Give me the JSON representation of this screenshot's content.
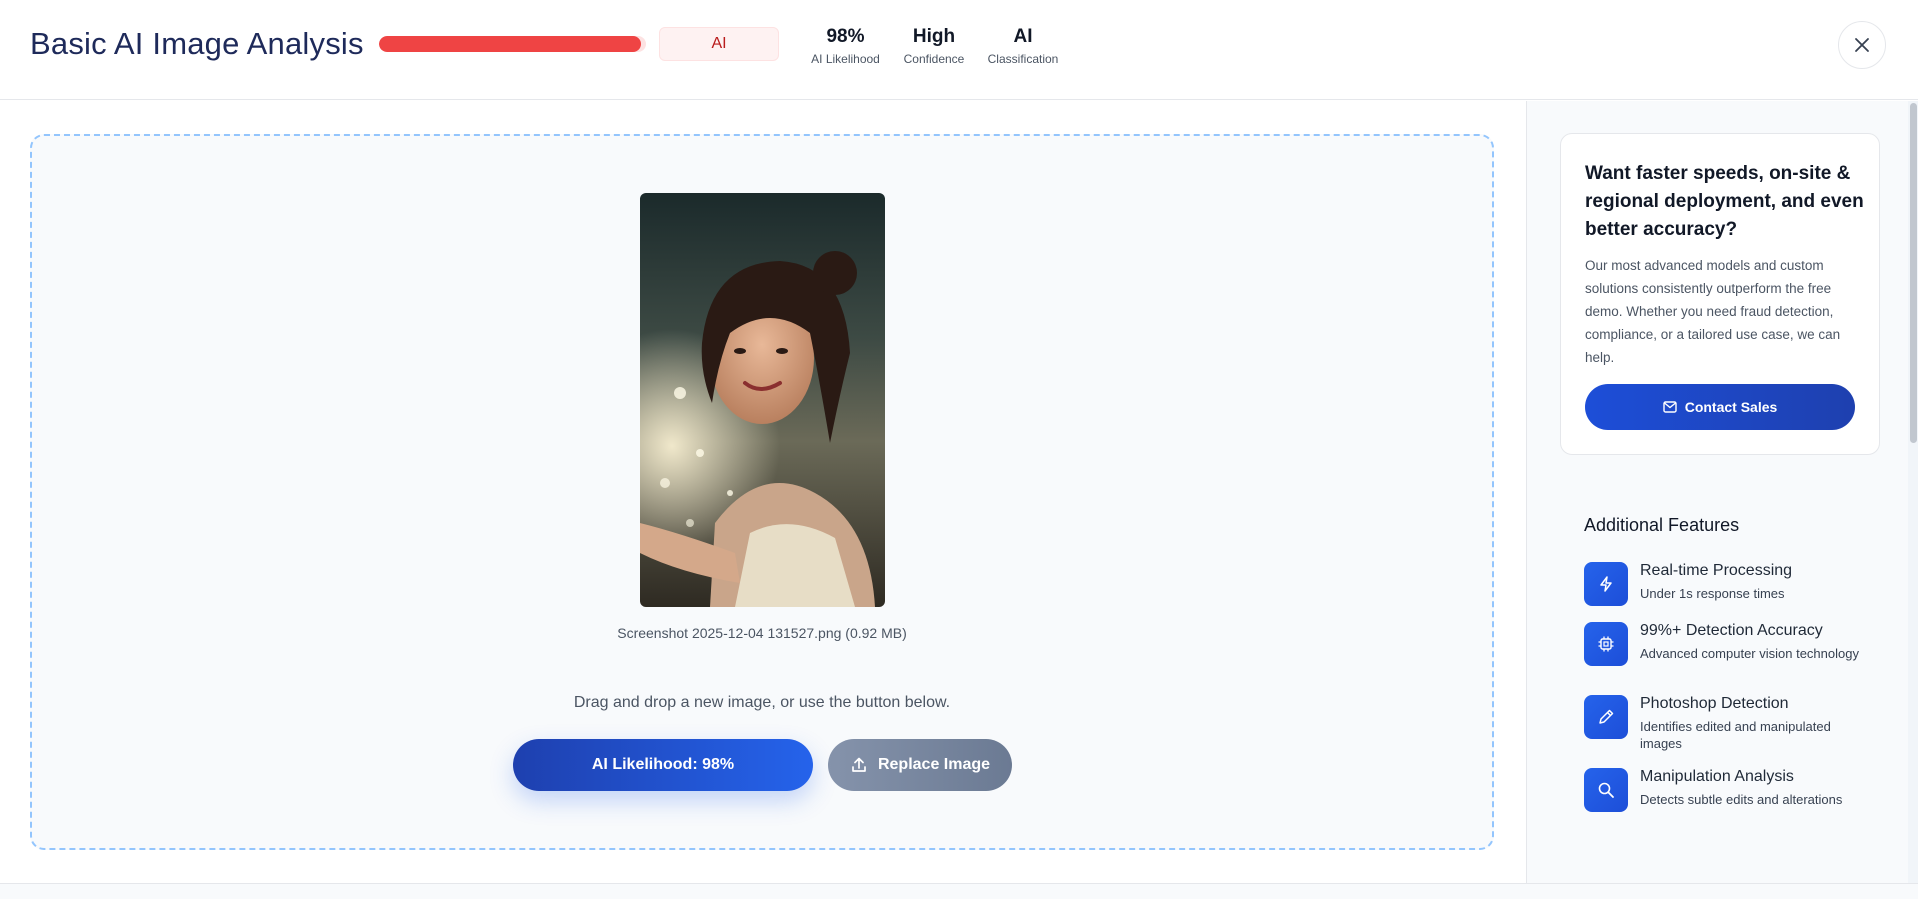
{
  "header": {
    "title": "Basic AI Image Analysis",
    "progress": {
      "value": 98,
      "max": 100,
      "color": "#ef4444"
    },
    "badge": "AI",
    "stats": [
      {
        "value": "98%",
        "label": "AI Likelihood"
      },
      {
        "value": "High",
        "label": "Confidence"
      },
      {
        "value": "AI",
        "label": "Classification"
      }
    ],
    "close_icon": "close-icon"
  },
  "main": {
    "preview_image": "portrait-photo",
    "file_info": "Screenshot 2025-12-04 131527.png (0.92 MB)",
    "drop_hint": "Drag and drop a new image, or use the button below.",
    "primary_button": "AI Likelihood: 98%",
    "replace_button": "Replace Image",
    "replace_icon": "upload-icon"
  },
  "sidebar": {
    "promo": {
      "title": "Want faster speeds, on-site & regional deployment, and even better accuracy?",
      "body": "Our most advanced models and custom solutions consistently outperform the free demo. Whether you need fraud detection, compliance, or a tailored use case, we can help.",
      "button": "Contact Sales",
      "button_icon": "mail-icon"
    },
    "features_title": "Additional Features",
    "features": [
      {
        "icon": "lightning-icon",
        "title": "Real-time Processing",
        "desc": "Under 1s response times"
      },
      {
        "icon": "chip-icon",
        "title": "99%+ Detection Accuracy",
        "desc": "Advanced computer vision technology"
      },
      {
        "icon": "pencil-icon",
        "title": "Photoshop Detection",
        "desc": "Identifies edited and manipulated images"
      },
      {
        "icon": "search-icon",
        "title": "Manipulation Analysis",
        "desc": "Detects subtle edits and alterations"
      }
    ]
  },
  "colors": {
    "accent": "#2563eb",
    "danger": "#ef4444",
    "title": "#1e2a5a"
  }
}
